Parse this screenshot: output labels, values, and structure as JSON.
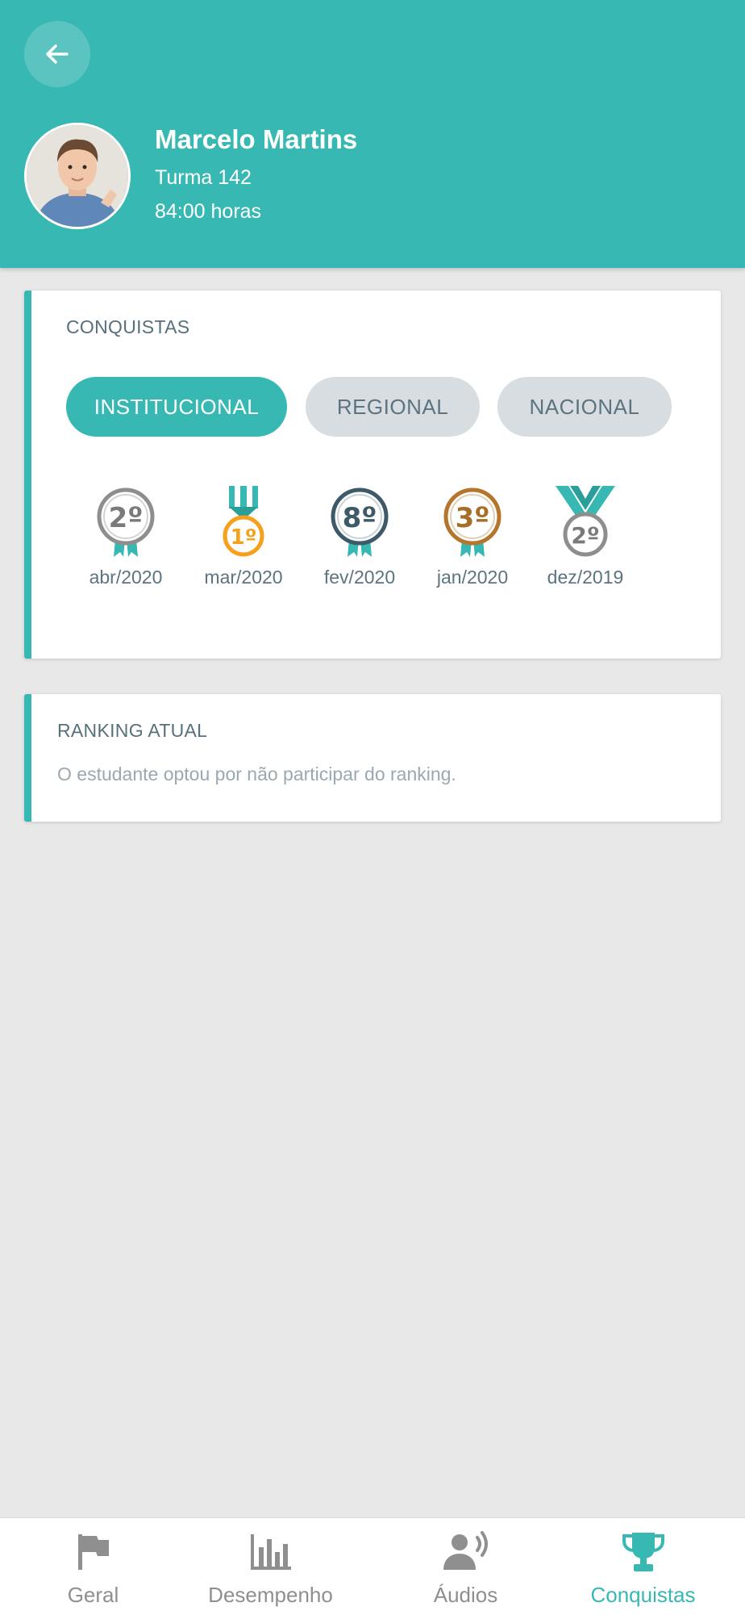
{
  "header": {
    "name": "Marcelo Martins",
    "class": "Turma 142",
    "hours": "84:00 horas"
  },
  "achievements": {
    "title": "CONQUISTAS",
    "tabs": [
      {
        "label": "INSTITUCIONAL",
        "active": true
      },
      {
        "label": "REGIONAL",
        "active": false
      },
      {
        "label": "NACIONAL",
        "active": false
      }
    ],
    "medals": [
      {
        "rank": "2º",
        "month": "abr/2020",
        "color": "#8e8e8e",
        "style": "ribbon-small"
      },
      {
        "rank": "1º",
        "month": "mar/2020",
        "color": "#f5a11c",
        "style": "bar-hanger"
      },
      {
        "rank": "8º",
        "month": "fev/2020",
        "color": "#3e5968",
        "style": "ribbon-small"
      },
      {
        "rank": "3º",
        "month": "jan/2020",
        "color": "#b5752a",
        "style": "ribbon-small"
      },
      {
        "rank": "2º",
        "month": "dez/2019",
        "color": "#8e8e8e",
        "style": "v-ribbon"
      }
    ]
  },
  "ranking": {
    "title": "RANKING ATUAL",
    "message": "O estudante optou por não participar do ranking."
  },
  "nav": {
    "items": [
      {
        "label": "Geral",
        "icon": "flag-icon",
        "active": false
      },
      {
        "label": "Desempenho",
        "icon": "bar-chart-icon",
        "active": false
      },
      {
        "label": "Áudios",
        "icon": "speaker-person-icon",
        "active": false
      },
      {
        "label": "Conquistas",
        "icon": "trophy-icon",
        "active": true
      }
    ]
  },
  "colors": {
    "accent": "#38b8b3",
    "inactive_tab": "#d7dde0",
    "nav_inactive": "#8f8f8f"
  }
}
